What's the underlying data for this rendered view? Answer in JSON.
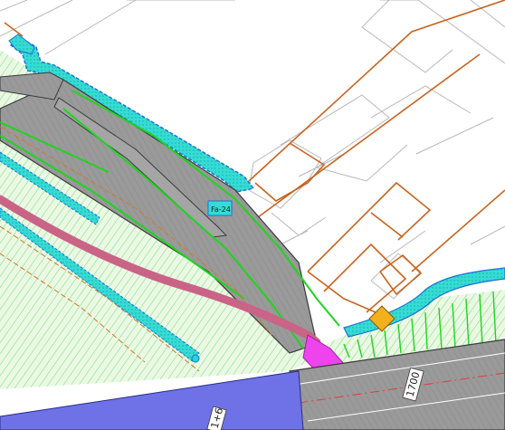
{
  "map": {
    "labels": {
      "chainage_primary": "1700",
      "chainage_secondary": "1+6",
      "structure_tag": "Fa-24"
    },
    "colors": {
      "background": "#ffffff",
      "parcel_line": "#b5b5b5",
      "property_boundary": "#c8641e",
      "vegetation_hatch": "#49d649",
      "vegetation_fill": "#e8f8e2",
      "road_surface": "#8e8e8e",
      "road_edge": "#3a3a3a",
      "embankment": "#27d6d0",
      "embankment_edge": "#1c6fd6",
      "bright_green_line": "#1fd41f",
      "pink_track": "#c96487",
      "magenta_track": "#ee44ee",
      "blue_zone": "#6e72e6",
      "warning_marker": "#f2b11c",
      "centerline": "#e43a3a"
    }
  }
}
